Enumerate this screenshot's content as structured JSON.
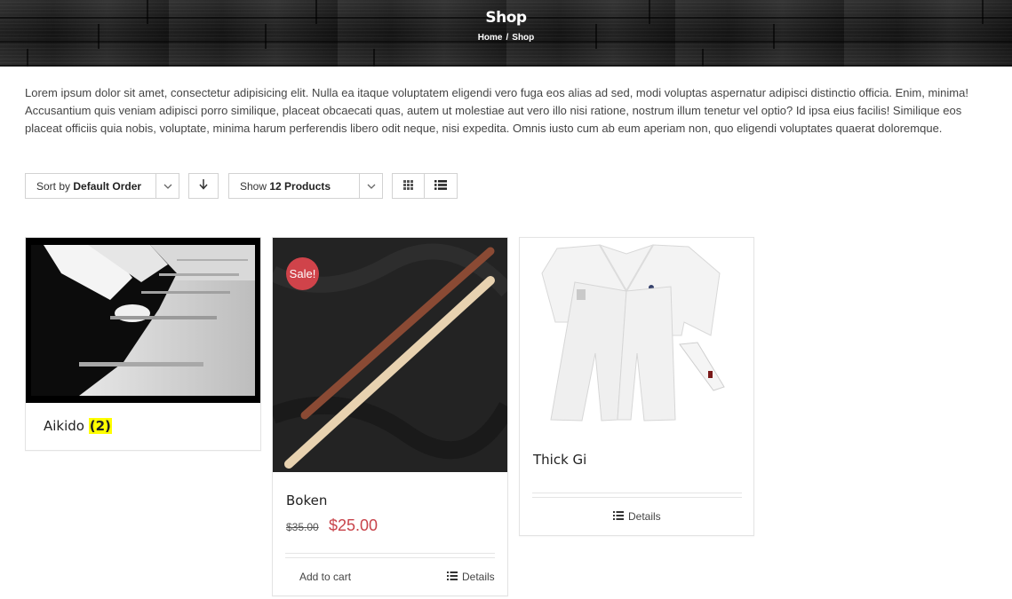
{
  "header": {
    "title": "Shop",
    "breadcrumb": {
      "home": "Home",
      "separator": "/",
      "current": "Shop"
    }
  },
  "description": "Lorem ipsum dolor sit amet, consectetur adipisicing elit. Nulla ea itaque voluptatem eligendi vero fuga eos alias ad sed, modi voluptas aspernatur adipisci distinctio officia. Enim, minima! Accusantium quis veniam adipisci porro similique, placeat obcaecati quas, autem ut molestiae aut vero illo nisi ratione, nostrum illum tenetur vel optio? Id ipsa eius facilis! Similique eos placeat officiis quia nobis, voluptate, minima harum perferendis libero odit neque, nisi expedita. Omnis iusto cum ab eum aperiam non, quo eligendi voluptates quaerat doloremque.",
  "toolbar": {
    "sort_prefix": "Sort by",
    "sort_value": "Default Order",
    "show_prefix": "Show",
    "show_value": "12 Products",
    "icons": {
      "sort_caret": "chevron-down-icon",
      "direction": "arrow-down-icon",
      "grid_view": "grid-icon",
      "list_view": "list-icon"
    }
  },
  "products": [
    {
      "title": "Aikido",
      "count": "(2)",
      "image": "black-and-white photo of kneeling aikido practitioners with wooden sticks"
    },
    {
      "title": "Boken",
      "badge": "Sale!",
      "old_price": "$35.00",
      "new_price": "$25.00",
      "add_to_cart": "Add to cart",
      "details": "Details",
      "image": "two wooden training swords on black cloth"
    },
    {
      "title": "Thick Gi",
      "details": "Details",
      "image": "white martial arts uniform with belt"
    }
  ],
  "colors": {
    "sale": "#d0434a",
    "price": "#c8434a",
    "count_highlight": "#ffff00"
  }
}
